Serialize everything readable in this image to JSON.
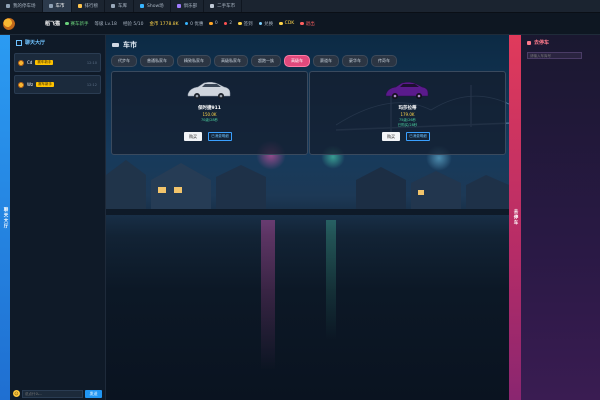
{
  "nav": {
    "tabs": [
      {
        "label": "我的停车场",
        "icon": "parking-icon",
        "active": false
      },
      {
        "label": "车市",
        "icon": "car-icon",
        "active": true
      },
      {
        "label": "排行榜",
        "icon": "trophy-icon",
        "active": false
      },
      {
        "label": "车库",
        "icon": "garage-icon",
        "active": false
      },
      {
        "label": "Show场",
        "icon": "show-icon",
        "active": false
      },
      {
        "label": "俱乐部",
        "icon": "club-icon",
        "active": false
      },
      {
        "label": "二手车市",
        "icon": "used-car-icon",
        "active": false
      }
    ]
  },
  "status": {
    "username": "稻飞猫",
    "badge": "赛车新手",
    "level": "等级 Lv.18",
    "exp": "经验 5/10",
    "money": "金币 1778.8K",
    "coupons": "0 优惠",
    "sign": "0",
    "mail": "2",
    "checkin_label": "签到",
    "exchange_label": "兑换",
    "cdk_label": "CDK",
    "exit_label": "退出"
  },
  "chat": {
    "side_label": "聊天大厅",
    "title": "聊天大厅",
    "messages": [
      {
        "name": "Cd",
        "vip": "赛车新手",
        "time": "12:10"
      },
      {
        "name": "Wz",
        "vip": "赛车新手",
        "time": "12:12"
      }
    ],
    "input_placeholder": "说点什么...",
    "send_label": "发送"
  },
  "market": {
    "title": "车市",
    "filters": [
      {
        "label": "代步车",
        "active": false
      },
      {
        "label": "普通私家车",
        "active": false
      },
      {
        "label": "精致私家车",
        "active": false
      },
      {
        "label": "高级私家车",
        "active": false
      },
      {
        "label": "超跑一族",
        "active": false
      },
      {
        "label": "高级车",
        "active": true
      },
      {
        "label": "赛道车",
        "active": false
      },
      {
        "label": "豪华车",
        "active": false
      },
      {
        "label": "传奇车",
        "active": false
      }
    ],
    "cars": [
      {
        "name": "保时捷911",
        "price": "150.0K",
        "spec": "70级/28秒",
        "spec2": "",
        "buy": "购买",
        "info": "已消费明细",
        "color": "#c9ced6"
      },
      {
        "name": "玛莎拉蒂",
        "price": "179.0K",
        "spec": "75级/26秒",
        "spec2": "已购买/28秒",
        "buy": "购买",
        "info": "已消费明细",
        "color": "#5a1b8c"
      }
    ]
  },
  "right": {
    "side_label": "去停车",
    "title": "去停车",
    "input_placeholder": "请输入车库号"
  }
}
